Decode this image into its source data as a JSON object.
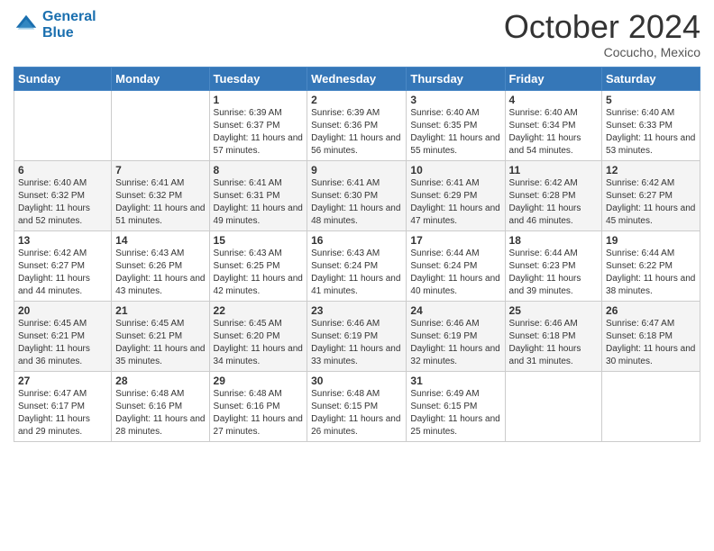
{
  "logo": {
    "line1": "General",
    "line2": "Blue"
  },
  "header": {
    "month": "October 2024",
    "location": "Cocucho, Mexico"
  },
  "weekdays": [
    "Sunday",
    "Monday",
    "Tuesday",
    "Wednesday",
    "Thursday",
    "Friday",
    "Saturday"
  ],
  "weeks": [
    [
      {
        "day": "",
        "info": ""
      },
      {
        "day": "",
        "info": ""
      },
      {
        "day": "1",
        "info": "Sunrise: 6:39 AM\nSunset: 6:37 PM\nDaylight: 11 hours and 57 minutes."
      },
      {
        "day": "2",
        "info": "Sunrise: 6:39 AM\nSunset: 6:36 PM\nDaylight: 11 hours and 56 minutes."
      },
      {
        "day": "3",
        "info": "Sunrise: 6:40 AM\nSunset: 6:35 PM\nDaylight: 11 hours and 55 minutes."
      },
      {
        "day": "4",
        "info": "Sunrise: 6:40 AM\nSunset: 6:34 PM\nDaylight: 11 hours and 54 minutes."
      },
      {
        "day": "5",
        "info": "Sunrise: 6:40 AM\nSunset: 6:33 PM\nDaylight: 11 hours and 53 minutes."
      }
    ],
    [
      {
        "day": "6",
        "info": "Sunrise: 6:40 AM\nSunset: 6:32 PM\nDaylight: 11 hours and 52 minutes."
      },
      {
        "day": "7",
        "info": "Sunrise: 6:41 AM\nSunset: 6:32 PM\nDaylight: 11 hours and 51 minutes."
      },
      {
        "day": "8",
        "info": "Sunrise: 6:41 AM\nSunset: 6:31 PM\nDaylight: 11 hours and 49 minutes."
      },
      {
        "day": "9",
        "info": "Sunrise: 6:41 AM\nSunset: 6:30 PM\nDaylight: 11 hours and 48 minutes."
      },
      {
        "day": "10",
        "info": "Sunrise: 6:41 AM\nSunset: 6:29 PM\nDaylight: 11 hours and 47 minutes."
      },
      {
        "day": "11",
        "info": "Sunrise: 6:42 AM\nSunset: 6:28 PM\nDaylight: 11 hours and 46 minutes."
      },
      {
        "day": "12",
        "info": "Sunrise: 6:42 AM\nSunset: 6:27 PM\nDaylight: 11 hours and 45 minutes."
      }
    ],
    [
      {
        "day": "13",
        "info": "Sunrise: 6:42 AM\nSunset: 6:27 PM\nDaylight: 11 hours and 44 minutes."
      },
      {
        "day": "14",
        "info": "Sunrise: 6:43 AM\nSunset: 6:26 PM\nDaylight: 11 hours and 43 minutes."
      },
      {
        "day": "15",
        "info": "Sunrise: 6:43 AM\nSunset: 6:25 PM\nDaylight: 11 hours and 42 minutes."
      },
      {
        "day": "16",
        "info": "Sunrise: 6:43 AM\nSunset: 6:24 PM\nDaylight: 11 hours and 41 minutes."
      },
      {
        "day": "17",
        "info": "Sunrise: 6:44 AM\nSunset: 6:24 PM\nDaylight: 11 hours and 40 minutes."
      },
      {
        "day": "18",
        "info": "Sunrise: 6:44 AM\nSunset: 6:23 PM\nDaylight: 11 hours and 39 minutes."
      },
      {
        "day": "19",
        "info": "Sunrise: 6:44 AM\nSunset: 6:22 PM\nDaylight: 11 hours and 38 minutes."
      }
    ],
    [
      {
        "day": "20",
        "info": "Sunrise: 6:45 AM\nSunset: 6:21 PM\nDaylight: 11 hours and 36 minutes."
      },
      {
        "day": "21",
        "info": "Sunrise: 6:45 AM\nSunset: 6:21 PM\nDaylight: 11 hours and 35 minutes."
      },
      {
        "day": "22",
        "info": "Sunrise: 6:45 AM\nSunset: 6:20 PM\nDaylight: 11 hours and 34 minutes."
      },
      {
        "day": "23",
        "info": "Sunrise: 6:46 AM\nSunset: 6:19 PM\nDaylight: 11 hours and 33 minutes."
      },
      {
        "day": "24",
        "info": "Sunrise: 6:46 AM\nSunset: 6:19 PM\nDaylight: 11 hours and 32 minutes."
      },
      {
        "day": "25",
        "info": "Sunrise: 6:46 AM\nSunset: 6:18 PM\nDaylight: 11 hours and 31 minutes."
      },
      {
        "day": "26",
        "info": "Sunrise: 6:47 AM\nSunset: 6:18 PM\nDaylight: 11 hours and 30 minutes."
      }
    ],
    [
      {
        "day": "27",
        "info": "Sunrise: 6:47 AM\nSunset: 6:17 PM\nDaylight: 11 hours and 29 minutes."
      },
      {
        "day": "28",
        "info": "Sunrise: 6:48 AM\nSunset: 6:16 PM\nDaylight: 11 hours and 28 minutes."
      },
      {
        "day": "29",
        "info": "Sunrise: 6:48 AM\nSunset: 6:16 PM\nDaylight: 11 hours and 27 minutes."
      },
      {
        "day": "30",
        "info": "Sunrise: 6:48 AM\nSunset: 6:15 PM\nDaylight: 11 hours and 26 minutes."
      },
      {
        "day": "31",
        "info": "Sunrise: 6:49 AM\nSunset: 6:15 PM\nDaylight: 11 hours and 25 minutes."
      },
      {
        "day": "",
        "info": ""
      },
      {
        "day": "",
        "info": ""
      }
    ]
  ]
}
